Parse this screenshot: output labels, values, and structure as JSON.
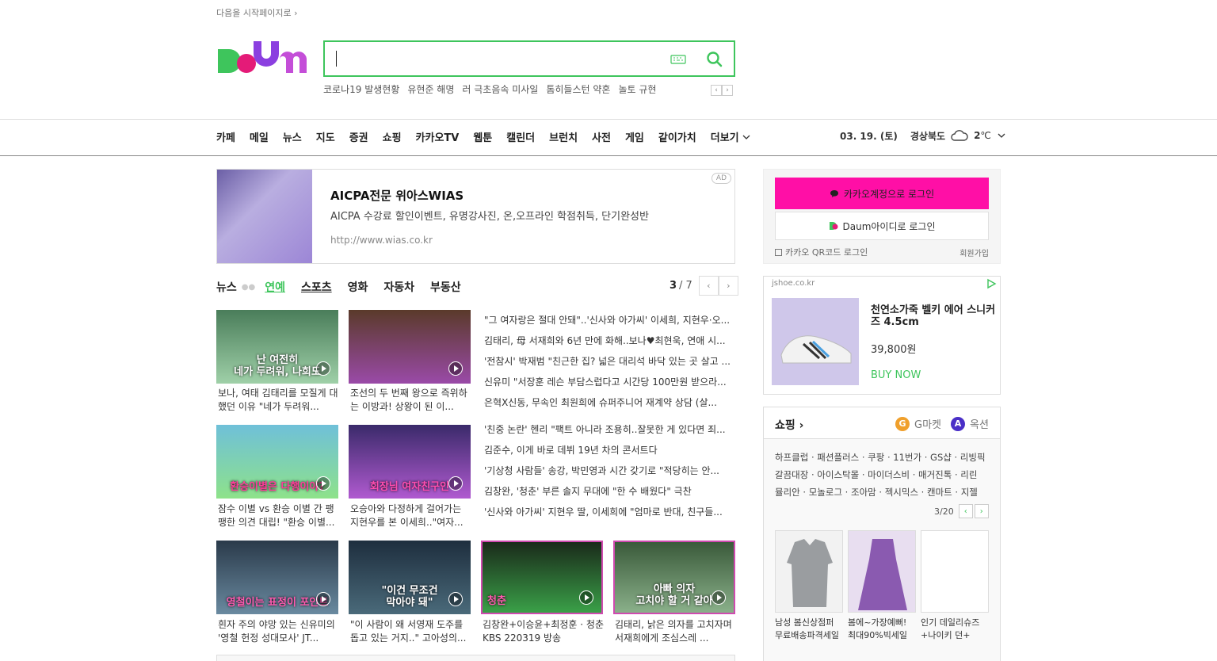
{
  "header": {
    "start_page_link": "다음을 시작페이지로",
    "logo_text": "Daum",
    "search_placeholder": "",
    "trending": [
      "코로나19 발생현황",
      "유현준 해명",
      "러 극초음속 미사일",
      "톰히들스턴 약혼",
      "놀토 규현"
    ]
  },
  "gnb": {
    "items": [
      "카페",
      "메일",
      "뉴스",
      "지도",
      "증권",
      "쇼핑",
      "카카오TV",
      "웹툰",
      "캘린더",
      "브런치",
      "사전",
      "게임",
      "같이가치"
    ],
    "more": "더보기",
    "date": "03. 19. (토)",
    "region": "경상북도",
    "temperature": "2",
    "temp_unit": "℃"
  },
  "ad": {
    "title": "AICPA전문 위아스WIAS",
    "description": "AICPA 수강료 할인이벤트, 유명강사진, 온,오프라인 학점취득, 단기완성반",
    "url": "http://www.wias.co.kr",
    "badge": "AD"
  },
  "news": {
    "tabs": [
      "뉴스",
      "연예",
      "스포츠",
      "영화",
      "자동차",
      "부동산"
    ],
    "active_tab": "연예",
    "page_current": "3",
    "page_total": "/ 7",
    "videos": [
      {
        "overlay": "난 여전히\n네가 두려워, 나희도",
        "caption": "보나, 여태 김태리를 모질게 대했던 이유 \"네가 두려워..."
      },
      {
        "overlay": "",
        "caption": "조선의 두 번째 왕으로 즉위하는 이방과! 상왕이 된 이..."
      },
      {
        "overlay": "환승이별은 다행이야?",
        "caption": "잠수 이별 vs 환승 이별 간 팽팽한 의견 대립! \"환승 이별..."
      },
      {
        "overlay": "회장님 여자친구인",
        "caption": "오승아와 다정하게 걸어가는 지현우를 본 이세희..\"여자..."
      },
      {
        "overlay": "영철이는 표정이 포인트",
        "caption": "흰자 주의 야망 있는 신유미의 '영철 헌정 성대모사' JT..."
      },
      {
        "overlay": "\"이건 무조건\n막아야 돼\"",
        "caption": "\"이 사람이 왜 서영재 도주를 돕고 있는 거지..\" 고아성의..."
      },
      {
        "overlay": "청춘",
        "caption": "김창완+이승윤+최정훈 · 청춘 KBS 220319 방송"
      },
      {
        "overlay": "아빠 의자\n고치야 할 거 같아",
        "caption": "김태리, 낡은 의자를 고치자며 서재희에게 조심스레 ..."
      }
    ],
    "headlines": [
      "\"그 여자랑은 절대 안돼\"..'신사와 아가씨' 이세희, 지현우·오...",
      "김태리, 母 서재희와 6년 만에 화해..보나♥최현욱, 연애 시...",
      "'전참시' 박재범 \"친근한 집? 넓은 대리석 바닥 있는 곳 살고 ...",
      "신유미 \"서장훈 레슨 부담스럽다고 시간당 100만원 받으라...",
      "은혁X신동, 무속인 최원희에 슈퍼주니어 재계약 상담 (살...",
      "'친중 논란' 헨리 \"팩트 아니라 조용히..잘못한 게 있다면 죄...",
      "김준수, 이게 바로 데뷔 19년 차의 콘서트다",
      "'기상청 사람들' 송강, 박민영과 시간 갖기로 \"적당히는 안...",
      "김창완, '청춘' 부른 솔지 무대에 \"한 수 배웠다\" 극찬",
      "'신사와 아가씨' 지현우 딸, 이세희에 \"엄마로 반대, 친구들..."
    ]
  },
  "login": {
    "kakao_button": "카카오계정으로 로그인",
    "daum_button": "Daum아이디로 로그인",
    "qr_login": "카카오 QR코드 로그인",
    "signup": "회원가입"
  },
  "shop_ad": {
    "domain": "jshoe.co.kr",
    "product_name": "천연소가죽 벨키 에어 스니커즈 4.5cm",
    "price": "39,800원",
    "buy": "BUY NOW"
  },
  "shopping": {
    "title": "쇼핑",
    "gmarket": "G마켓",
    "auction": "옥션",
    "links_line1": "하프클럽 · 패션플러스 · 쿠팡 · 11번가 · GS샵 · 리빙픽",
    "links_line2": "갈끔대장 · 아이스탁몰 · 마이더스비 · 매거진톡 · 리린",
    "links_line3": "뮬리안 · 모놀로그 · 조아맘 · 젝시믹스 · 캔마트 · 지젤",
    "page": "3/20",
    "products": [
      {
        "caption": "남성 봄신상점퍼\n무료배송파격세일"
      },
      {
        "caption": "봄에~가장예뻐!\n최대90%빅세일"
      },
      {
        "caption": "인기 데일리슈즈\n+나이키 던+"
      }
    ]
  },
  "colors": {
    "accent": "#3ec55c",
    "kakao": "#ff0fa6"
  }
}
